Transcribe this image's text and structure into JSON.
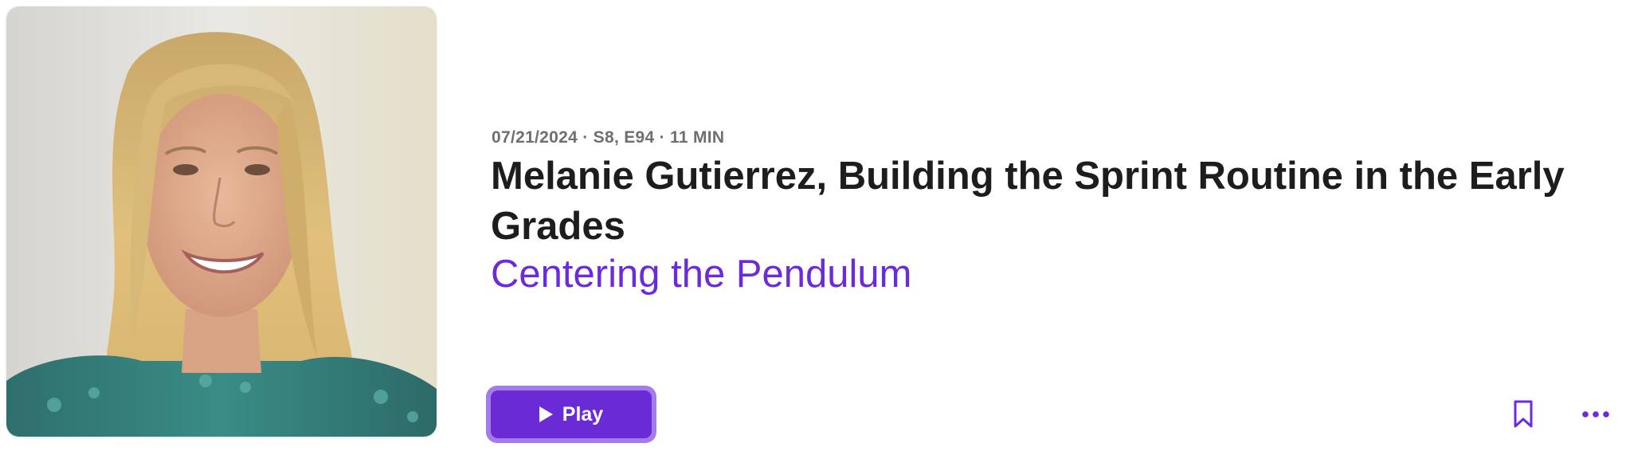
{
  "episode": {
    "meta": "07/21/2024 · S8, E94 · 11 MIN",
    "title": "Melanie Gutierrez, Building the Sprint Routine in the Early Grades",
    "show_name": "Centering the Pendulum"
  },
  "actions": {
    "play_label": "Play",
    "bookmark_icon": "bookmark-icon",
    "more_icon": "ellipsis-icon"
  },
  "colors": {
    "accent": "#6c2bd9",
    "play_button": "#6a2bd6",
    "play_ring": "#a47be8",
    "meta_text": "#6e6e73",
    "title_text": "#1d1d1f"
  }
}
